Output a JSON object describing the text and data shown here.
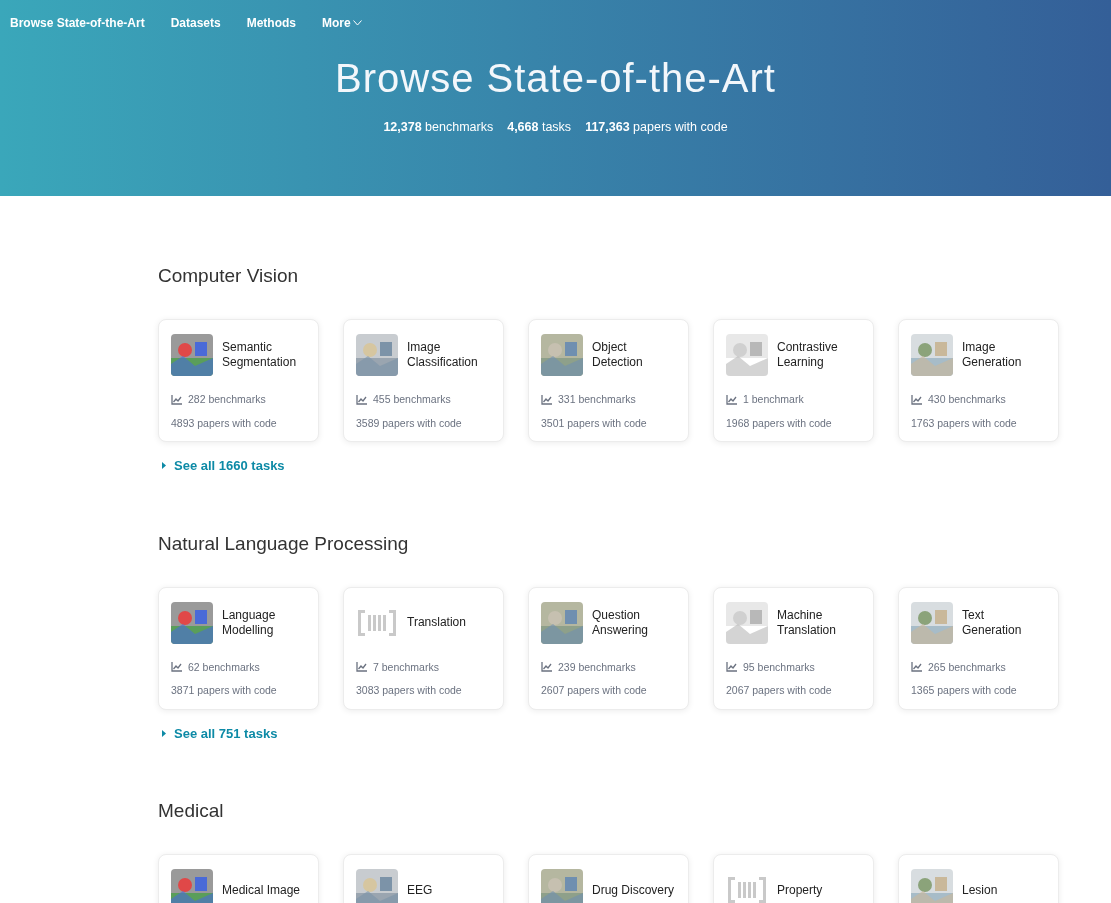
{
  "nav": {
    "brand": "Browse State-of-the-Art",
    "links": [
      {
        "label": "Datasets",
        "dropdown": false
      },
      {
        "label": "Methods",
        "dropdown": false
      },
      {
        "label": "More",
        "dropdown": true
      }
    ]
  },
  "hero": {
    "title": "Browse State-of-the-Art",
    "stats": [
      "**12,378** benchmarks",
      "**4,668** tasks",
      "**117,363** papers with code"
    ]
  },
  "sections": [
    {
      "title": "Computer Vision",
      "see_all": "See all 1660 tasks",
      "cards": [
        {
          "title": "Semantic Segmentation",
          "kind": "picture",
          "benchmarks": "282 benchmarks",
          "papers": "4893 papers with code"
        },
        {
          "title": "Image Classification",
          "kind": "picture",
          "benchmarks": "455 benchmarks",
          "papers": "3589 papers with code"
        },
        {
          "title": "Object Detection",
          "kind": "picture",
          "benchmarks": "331 benchmarks",
          "papers": "3501 papers with code"
        },
        {
          "title": "Contrastive Learning",
          "kind": "picture",
          "benchmarks": "1 benchmark",
          "papers": "1968 papers with code"
        },
        {
          "title": "Image Generation",
          "kind": "picture",
          "benchmarks": "430 benchmarks",
          "papers": "1763 papers with code"
        }
      ]
    },
    {
      "title": "Natural Language Processing",
      "see_all": "See all 751 tasks",
      "cards": [
        {
          "title": "Language Modelling",
          "kind": "picture",
          "benchmarks": "62 benchmarks",
          "papers": "3871 papers with code"
        },
        {
          "title": "Translation",
          "kind": "placeholder",
          "benchmarks": "7 benchmarks",
          "papers": "3083 papers with code"
        },
        {
          "title": "Question Answering",
          "kind": "picture",
          "benchmarks": "239 benchmarks",
          "papers": "2607 papers with code"
        },
        {
          "title": "Machine Translation",
          "kind": "picture",
          "benchmarks": "95 benchmarks",
          "papers": "2067 papers with code"
        },
        {
          "title": "Text Generation",
          "kind": "picture",
          "benchmarks": "265 benchmarks",
          "papers": "1365 papers with code"
        }
      ]
    },
    {
      "title": "Medical",
      "cards": [
        {
          "title": "Medical Image",
          "kind": "picture"
        },
        {
          "title": "EEG",
          "kind": "picture"
        },
        {
          "title": "Drug Discovery",
          "kind": "picture"
        },
        {
          "title": "Property",
          "kind": "placeholder"
        },
        {
          "title": "Lesion",
          "kind": "picture"
        }
      ]
    }
  ]
}
